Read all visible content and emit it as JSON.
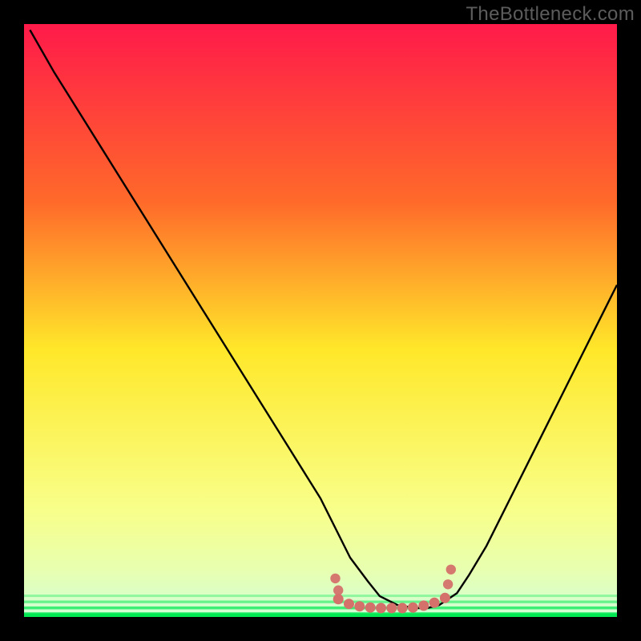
{
  "watermark": "TheBottleneck.com",
  "colors": {
    "gradient_top": "#ff1a4a",
    "gradient_mid_upper": "#ff8b2a",
    "gradient_mid": "#ffe82a",
    "gradient_low": "#fff9c0",
    "green": "#00e952",
    "bottom_band": "#00e952",
    "curve": "#000000",
    "marker": "#d4716a",
    "bg": "#000000"
  },
  "chart_data": {
    "type": "line",
    "title": "",
    "xlabel": "",
    "ylabel": "",
    "xlim": [
      0,
      100
    ],
    "ylim": [
      0,
      100
    ],
    "curve": {
      "name": "bottleneck-curve",
      "x": [
        1,
        5,
        10,
        15,
        20,
        25,
        30,
        35,
        40,
        45,
        50,
        53,
        55,
        58,
        60,
        63,
        66,
        68,
        70,
        73,
        75,
        78,
        82,
        86,
        90,
        94,
        98,
        100
      ],
      "y": [
        99,
        92,
        84,
        76,
        68,
        60,
        52,
        44,
        36,
        28,
        20,
        14,
        10,
        6,
        3.5,
        2,
        1.5,
        1.5,
        2,
        4,
        7,
        12,
        20,
        28,
        36,
        44,
        52,
        56
      ]
    },
    "flat_marker": {
      "name": "optimal-zone",
      "x": [
        53,
        54.8,
        56.6,
        58.4,
        60.2,
        62,
        63.8,
        65.6,
        67.4,
        69.2,
        71
      ],
      "y": [
        3.0,
        2.2,
        1.8,
        1.6,
        1.5,
        1.5,
        1.5,
        1.6,
        1.9,
        2.4,
        3.2
      ]
    },
    "side_markers": [
      {
        "x": 52.5,
        "y": 6.5
      },
      {
        "x": 53.0,
        "y": 4.5
      },
      {
        "x": 71.5,
        "y": 5.5
      },
      {
        "x": 72.0,
        "y": 8.0
      }
    ]
  }
}
